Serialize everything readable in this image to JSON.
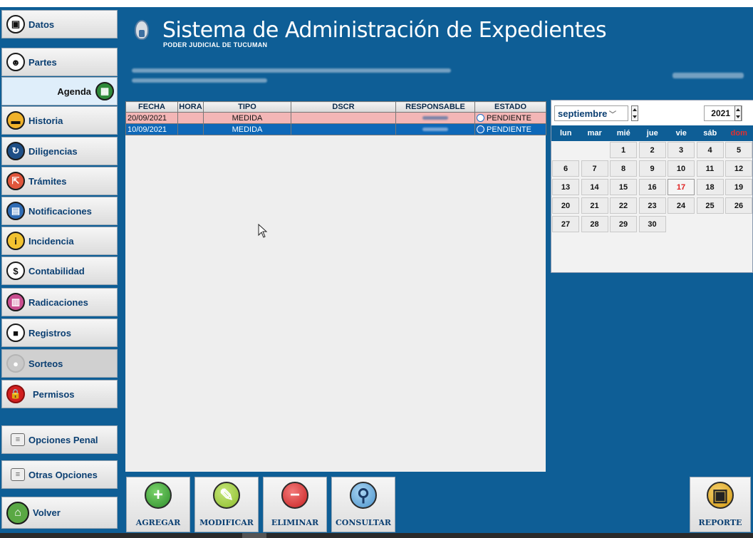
{
  "header": {
    "title": "Sistema de Administración de Expedientes",
    "subtitle": "PODER JUDICIAL DE TUCUMAN"
  },
  "sidebar": {
    "items": [
      {
        "name": "sidebar-item-datos",
        "label": "Datos",
        "icon": "folder-icon"
      },
      {
        "name": "sidebar-item-partes",
        "label": "Partes",
        "icon": "people-icon"
      },
      {
        "name": "sidebar-item-agenda",
        "label": "Agenda",
        "icon": "calendar-icon"
      },
      {
        "name": "sidebar-item-historia",
        "label": "Historia",
        "icon": "folder-open-icon"
      },
      {
        "name": "sidebar-item-diligencias",
        "label": "Diligencias",
        "icon": "refresh-icon"
      },
      {
        "name": "sidebar-item-tramites",
        "label": "Trámites",
        "icon": "export-icon"
      },
      {
        "name": "sidebar-item-notificaciones",
        "label": "Notificaciones",
        "icon": "notification-icon"
      },
      {
        "name": "sidebar-item-incidencia",
        "label": "Incidencia",
        "icon": "info-icon"
      },
      {
        "name": "sidebar-item-contabilidad",
        "label": "Contabilidad",
        "icon": "dollar-icon"
      },
      {
        "name": "sidebar-item-radicaciones",
        "label": "Radicaciones",
        "icon": "document-icon"
      },
      {
        "name": "sidebar-item-registros",
        "label": "Registros",
        "icon": "book-icon"
      },
      {
        "name": "sidebar-item-sorteos",
        "label": "Sorteos",
        "icon": "dice-icon"
      },
      {
        "name": "sidebar-item-permisos",
        "label": "Permisos",
        "icon": "lock-icon"
      },
      {
        "name": "sidebar-item-opciones-penal",
        "label": "Opciones Penal",
        "icon": "list-icon"
      },
      {
        "name": "sidebar-item-otras-opciones",
        "label": "Otras Opciones",
        "icon": "list-icon"
      },
      {
        "name": "sidebar-item-volver",
        "label": "Volver",
        "icon": "home-icon"
      }
    ]
  },
  "grid": {
    "columns": [
      "FECHA",
      "HORA",
      "TIPO",
      "DSCR",
      "RESPONSABLE",
      "ESTADO"
    ],
    "rows": [
      {
        "fecha": "20/09/2021",
        "hora": "",
        "tipo": "MEDIDA",
        "dscr": "",
        "estado": "PENDIENTE"
      },
      {
        "fecha": "10/09/2021",
        "hora": "",
        "tipo": "MEDIDA",
        "dscr": "",
        "estado": "PENDIENTE"
      }
    ]
  },
  "calendar": {
    "month": "septiembre",
    "year": "2021",
    "weekdays": [
      "lun",
      "mar",
      "mié",
      "jue",
      "vie",
      "sáb",
      "dom"
    ],
    "first_weekday_index": 2,
    "days_in_month": 30,
    "today": 17
  },
  "actions": {
    "agregar": "AGREGAR",
    "modificar": "MODIFICAR",
    "eliminar": "ELIMINAR",
    "consultar": "CONSULTAR",
    "reporte": "REPORTE"
  },
  "colors": {
    "background": "#0e5e96",
    "row_highlight": "#f3b6b6",
    "row_selected": "#0e68b8",
    "today": "#e02020"
  }
}
